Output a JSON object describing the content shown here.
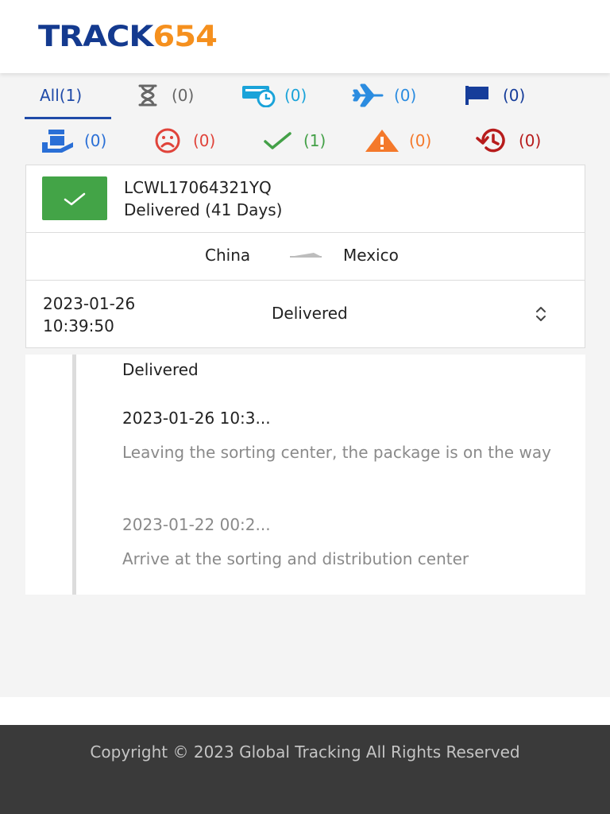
{
  "brand": {
    "logo_part1": "TRACK",
    "logo_part2": "654"
  },
  "tabs_row1": [
    {
      "id": "all",
      "label": "All(1)"
    },
    {
      "id": "pending",
      "icon": "hourglass-icon",
      "count": "(0)",
      "color": "#666666"
    },
    {
      "id": "info-received",
      "icon": "truck-clock-icon",
      "count": "(0)",
      "color": "#1aa3d9"
    },
    {
      "id": "in-transit",
      "icon": "airplane-icon",
      "count": "(0)",
      "color": "#2b8ce0"
    },
    {
      "id": "arrived",
      "icon": "flag-icon",
      "count": "(0)",
      "color": "#163d9a"
    }
  ],
  "tabs_row2": [
    {
      "id": "pickup",
      "icon": "parcel-hand-icon",
      "count": "(0)",
      "color": "#2a6fd6"
    },
    {
      "id": "undelivered",
      "icon": "sad-face-icon",
      "count": "(0)",
      "color": "#e0433a"
    },
    {
      "id": "delivered",
      "icon": "check-icon",
      "count": "(1)",
      "color": "#43a047"
    },
    {
      "id": "alert",
      "icon": "warning-icon",
      "count": "(0)",
      "color": "#f4792b"
    },
    {
      "id": "expired",
      "icon": "history-icon",
      "count": "(0)",
      "color": "#b71c1c"
    }
  ],
  "shipment": {
    "tracking_number": "LCWL17064321YQ",
    "status_summary": "Delivered (41 Days)",
    "status_color": "#43a447",
    "origin": "China",
    "destination": "Mexico",
    "last_event_date": "2023-01-26",
    "last_event_time": "10:39:50",
    "last_event_status": "Delivered"
  },
  "timeline": [
    {
      "text": "Delivered"
    },
    {
      "text": "2023-01-26 10:3..."
    },
    {
      "text": "Leaving the sorting center, the package is on the way"
    },
    {
      "text": "2023-01-22 00:2..."
    },
    {
      "text": "Arrive at the sorting and distribution center"
    }
  ],
  "footer": {
    "copyright": "Copyright © 2023 Global Tracking All Rights Reserved"
  }
}
